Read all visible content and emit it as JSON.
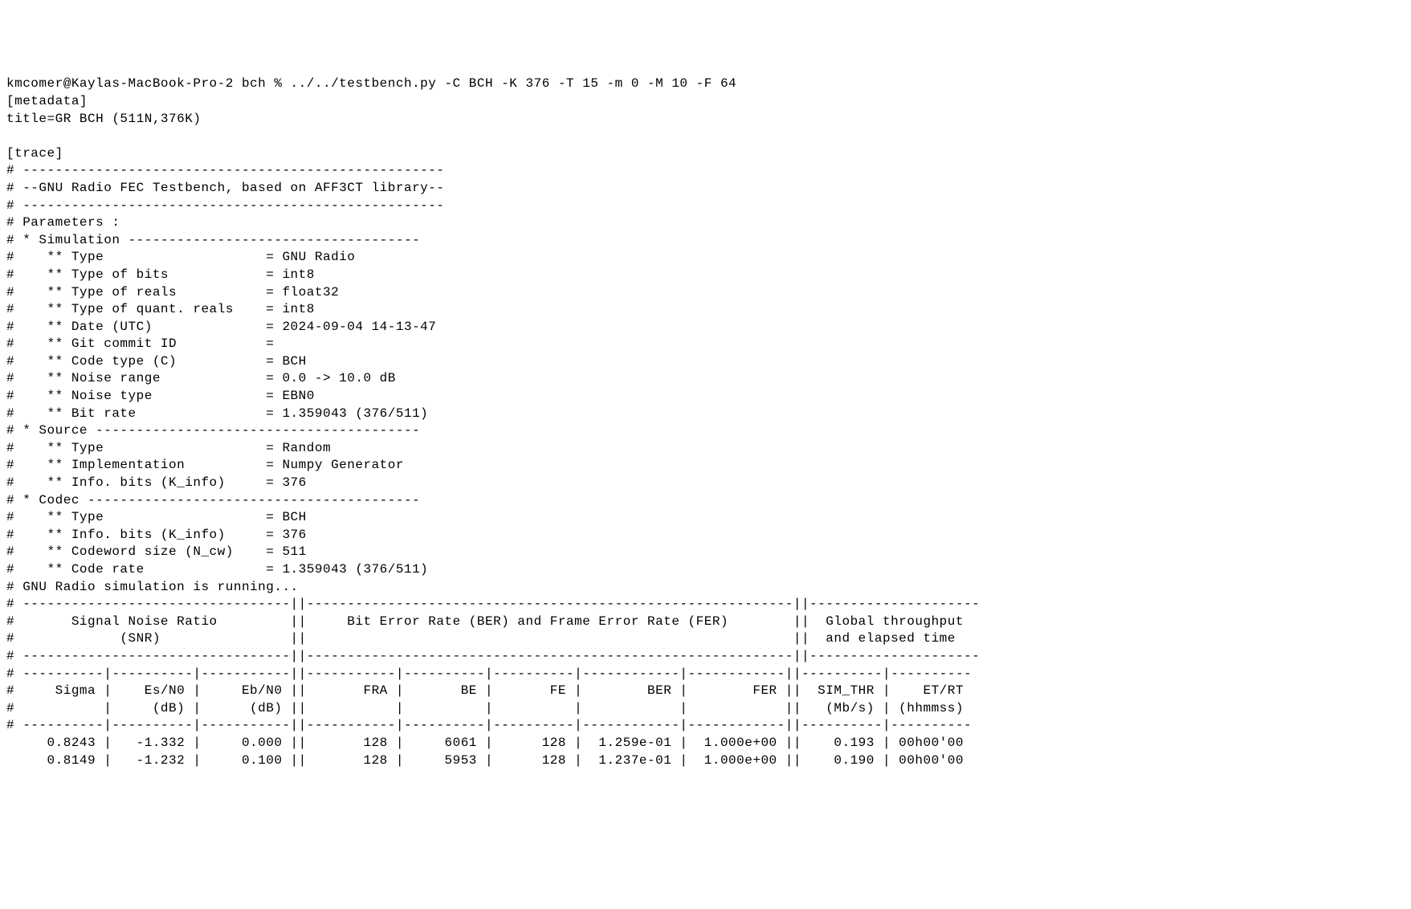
{
  "prompt": "kmcomer@Kaylas-MacBook-Pro-2 bch % ../../testbench.py -C BCH -K 376 -T 15 -m 0 -M 10 -F 64",
  "metadata_header": "[metadata]",
  "title_line": "title=GR BCH (511N,376K)",
  "trace_header": "[trace]",
  "sep1": "# ----------------------------------------------------",
  "banner": "# --GNU Radio FEC Testbench, based on AFF3CT library--",
  "sep2": "# ----------------------------------------------------",
  "params_header": "# Parameters :",
  "sim_section": "# * Simulation ------------------------------------",
  "sim": {
    "type": "#    ** Type                    = GNU Radio",
    "bits": "#    ** Type of bits            = int8",
    "reals": "#    ** Type of reals           = float32",
    "quant": "#    ** Type of quant. reals    = int8",
    "date": "#    ** Date (UTC)              = 2024-09-04 14-13-47",
    "git": "#    ** Git commit ID           =",
    "code": "#    ** Code type (C)           = BCH",
    "noise_range": "#    ** Noise range             = 0.0 -> 10.0 dB",
    "noise_type": "#    ** Noise type              = EBN0",
    "bit_rate": "#    ** Bit rate                = 1.359043 (376/511)"
  },
  "source_section": "# * Source ----------------------------------------",
  "source": {
    "type": "#    ** Type                    = Random",
    "impl": "#    ** Implementation          = Numpy Generator",
    "info": "#    ** Info. bits (K_info)     = 376"
  },
  "codec_section": "# * Codec -----------------------------------------",
  "codec": {
    "type": "#    ** Type                    = BCH",
    "info": "#    ** Info. bits (K_info)     = 376",
    "cw": "#    ** Codeword size (N_cw)    = 511",
    "rate": "#    ** Code rate               = 1.359043 (376/511)"
  },
  "running": "# GNU Radio simulation is running...",
  "table": {
    "hr1": "# ---------------------------------||------------------------------------------------------------||---------------------",
    "hdr1a": "#       Signal Noise Ratio         ||     Bit Error Rate (BER) and Frame Error Rate (FER)        ||  Global throughput  ",
    "hdr1b": "#             (SNR)                ||                                                            ||  and elapsed time   ",
    "hr2": "# ---------------------------------||------------------------------------------------------------||---------------------",
    "hr3": "# ----------|----------|-----------||-----------|----------|----------|------------|------------||----------|----------",
    "hdr2a": "#     Sigma |    Es/N0 |     Eb/N0 ||       FRA |       BE |       FE |        BER |        FER ||  SIM_THR |    ET/RT ",
    "hdr2b": "#           |     (dB) |      (dB) ||           |          |          |            |            ||   (Mb/s) | (hhmmss) ",
    "hr4": "# ----------|----------|-----------||-----------|----------|----------|------------|------------||----------|----------",
    "row1": "     0.8243 |   -1.332 |     0.000 ||       128 |     6061 |      128 |  1.259e-01 |  1.000e+00 ||    0.193 | 00h00'00 ",
    "row2": "     0.8149 |   -1.232 |     0.100 ||       128 |     5953 |      128 |  1.237e-01 |  1.000e+00 ||    0.190 | 00h00'00 "
  },
  "chart_data": {
    "type": "table",
    "title": "GR BCH (511N,376K)",
    "columns": [
      "Sigma",
      "Es/N0 (dB)",
      "Eb/N0 (dB)",
      "FRA",
      "BE",
      "FE",
      "BER",
      "FER",
      "SIM_THR (Mb/s)",
      "ET/RT (hhmmss)"
    ],
    "rows": [
      [
        0.8243,
        -1.332,
        0.0,
        128,
        6061,
        128,
        0.1259,
        1.0,
        0.193,
        "00h00'00"
      ],
      [
        0.8149,
        -1.232,
        0.1,
        128,
        5953,
        128,
        0.1237,
        1.0,
        0.19,
        "00h00'00"
      ]
    ],
    "parameters": {
      "simulation": {
        "Type": "GNU Radio",
        "Type of bits": "int8",
        "Type of reals": "float32",
        "Type of quant. reals": "int8",
        "Date (UTC)": "2024-09-04 14-13-47",
        "Git commit ID": "",
        "Code type (C)": "BCH",
        "Noise range": "0.0 -> 10.0 dB",
        "Noise type": "EBN0",
        "Bit rate": "1.359043 (376/511)"
      },
      "source": {
        "Type": "Random",
        "Implementation": "Numpy Generator",
        "Info. bits (K_info)": 376
      },
      "codec": {
        "Type": "BCH",
        "Info. bits (K_info)": 376,
        "Codeword size (N_cw)": 511,
        "Code rate": "1.359043 (376/511)"
      }
    }
  }
}
